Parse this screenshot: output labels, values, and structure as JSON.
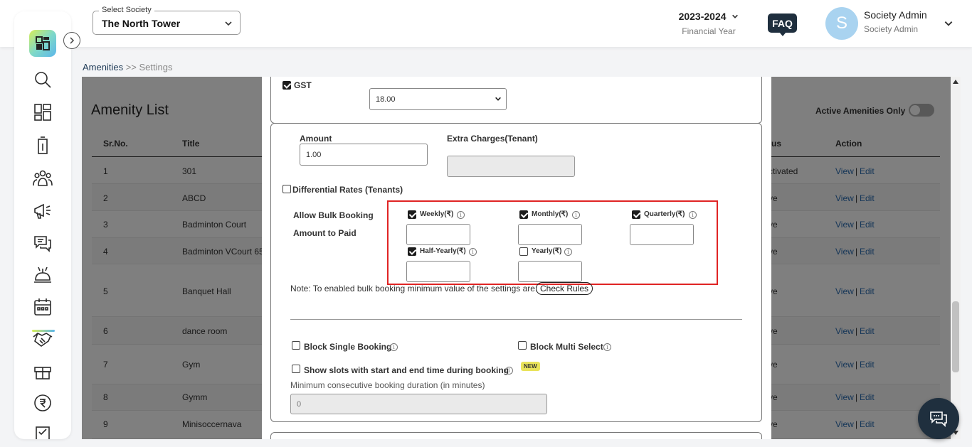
{
  "header": {
    "society_label": "Select Society",
    "society_value": "The North Tower",
    "financial_year": "2023-2024",
    "financial_year_label": "Financial Year",
    "faq": "FAQ",
    "avatar_letter": "S",
    "user_name": "Society Admin",
    "user_role": "Society Admin"
  },
  "breadcrumb": {
    "root": "Amenities",
    "separator": ">>",
    "current": "Settings"
  },
  "sidebar": {
    "icons": [
      "search-icon",
      "dashboard-icon",
      "building-icon",
      "members-icon",
      "announcement-icon",
      "chat-icon",
      "services-icon",
      "calendar-icon",
      "handshake-icon",
      "gift-icon",
      "rupee-icon",
      "document-icon"
    ]
  },
  "amenity_list": {
    "title": "Amenity List",
    "active_only_label": "Active Amenities Only",
    "columns": {
      "sr": "Sr.No.",
      "title": "Title",
      "status": "tus",
      "action": "Action"
    },
    "rows": [
      {
        "sr": "1",
        "title": "301",
        "status": "ctivated",
        "view": "View",
        "sep": "|",
        "edit": "Edit"
      },
      {
        "sr": "2",
        "title": "ABCD",
        "status": "ve",
        "view": "View",
        "sep": "|",
        "edit": "Edit"
      },
      {
        "sr": "3",
        "title": "Badminton Court",
        "status": "ve",
        "view": "View",
        "sep": "|",
        "edit": "Edit"
      },
      {
        "sr": "4",
        "title": "Badminton VCourt 65",
        "status": "ve",
        "view": "View",
        "sep": "|",
        "edit": "Edit"
      },
      {
        "sr": "5",
        "title": "Banquet Hall",
        "status": "ve",
        "view": "View",
        "sep": "|",
        "edit": "Edit"
      },
      {
        "sr": "6",
        "title": "dance room",
        "status": "ve",
        "view": "View",
        "sep": "|",
        "edit": "Edit"
      },
      {
        "sr": "7",
        "title": "Gym",
        "status": "ve",
        "view": "View",
        "sep": "|",
        "edit": "Edit"
      },
      {
        "sr": "8",
        "title": "Gymm",
        "status": "ve",
        "view": "View",
        "sep": "|",
        "edit": "Edit"
      },
      {
        "sr": "9",
        "title": "Minisoccernava",
        "status": "ve",
        "view": "View",
        "sep": "|",
        "edit": "Edit"
      }
    ]
  },
  "modal": {
    "gst_label": "GST",
    "gst_value": "18.00",
    "amount_label": "Amount",
    "amount_value": "1.00",
    "extra_charges_label": "Extra Charges(Tenant)",
    "differential_rates_label": "Differential Rates (Tenants)",
    "allow_bulk_label": "Allow Bulk Booking",
    "amount_to_paid_label": "Amount to Paid",
    "bulk": {
      "weekly": "Weekly(₹)",
      "monthly": "Monthly(₹)",
      "quarterly": "Quarterly(₹)",
      "half_yearly": "Half-Yearly(₹)",
      "yearly": "Yearly(₹)"
    },
    "info_glyph": "i",
    "note": "Note: To enabled bulk booking minimum value of the settings are:",
    "check_rules": "Check Rules",
    "block_single_label": "Block Single Booking",
    "block_multi_label": "Block Multi Select",
    "show_slots_label": "Show slots with start and end time during booking",
    "new_badge": "NEW",
    "min_duration_label": "Minimum consecutive booking duration (in minutes)",
    "min_duration_value": "0"
  }
}
